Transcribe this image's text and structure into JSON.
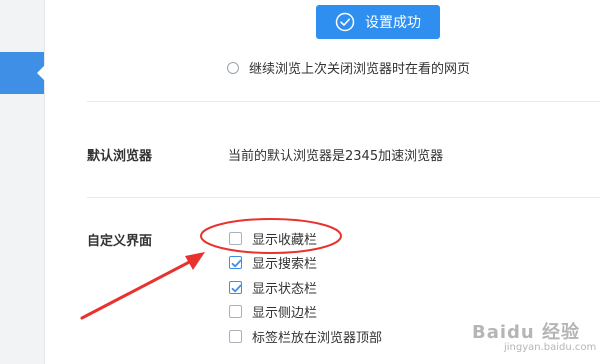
{
  "toast": {
    "text": "设置成功",
    "icon": "check-circle-icon"
  },
  "startup": {
    "option_label": "继续浏览上次关闭浏览器时在看的网页",
    "selected": false
  },
  "default_browser": {
    "label": "默认浏览器",
    "status_text": "当前的默认浏览器是2345加速浏览器"
  },
  "custom_ui": {
    "label": "自定义界面",
    "options": [
      {
        "label": "显示收藏栏",
        "checked": false
      },
      {
        "label": "显示搜索栏",
        "checked": true
      },
      {
        "label": "显示状态栏",
        "checked": true
      },
      {
        "label": "显示侧边栏",
        "checked": false
      },
      {
        "label": "标签栏放在浏览器顶部",
        "checked": false
      }
    ]
  },
  "watermark": {
    "main": "Baidu 经验",
    "sub": "jingyan.baidu.com"
  },
  "colors": {
    "accent": "#2e8ff0",
    "annotation": "#e8322f"
  }
}
